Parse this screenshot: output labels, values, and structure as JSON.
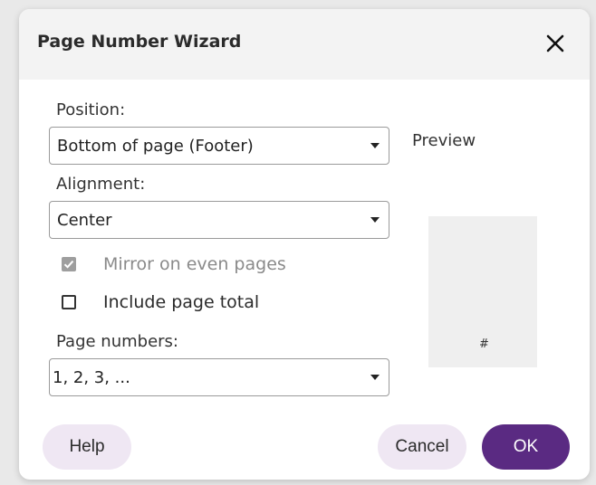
{
  "dialog": {
    "title": "Page Number Wizard",
    "close_icon": "close-icon"
  },
  "position": {
    "label": "Position:",
    "selected": "Bottom of page (Footer)"
  },
  "alignment": {
    "label": "Alignment:",
    "selected": "Center"
  },
  "mirror_even_pages": {
    "label": "Mirror on even pages",
    "checked": true,
    "disabled": true
  },
  "include_page_total": {
    "label": "Include page total",
    "checked": false
  },
  "page_numbers": {
    "label": "Page numbers:",
    "selected": "1, 2, 3, ..."
  },
  "preview": {
    "label": "Preview",
    "symbol": "#"
  },
  "buttons": {
    "help": "Help",
    "cancel": "Cancel",
    "ok": "OK"
  },
  "colors": {
    "accent": "#5a2a82",
    "secondary_button": "#efe7f3",
    "checkbox_disabled": "#9e9e9e"
  }
}
